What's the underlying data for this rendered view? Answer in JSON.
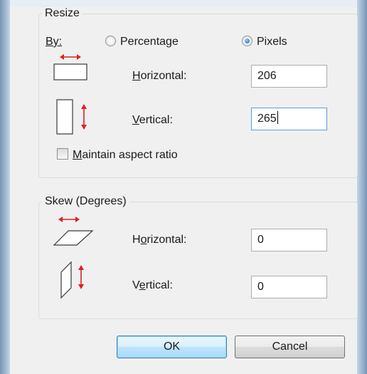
{
  "resize": {
    "legend": "Resize",
    "by_label": "By:",
    "percentage_label": "Percentage",
    "pixels_label": "Pixels",
    "selected": "Pixels",
    "horizontal_label": "Horizontal:",
    "horizontal_value": "206",
    "vertical_label": "Vertical:",
    "vertical_value": "265",
    "maintain_label": "Maintain aspect ratio",
    "maintain_checked": false
  },
  "skew": {
    "legend": "Skew (Degrees)",
    "horizontal_label": "Horizontal:",
    "horizontal_value": "0",
    "vertical_label": "Vertical:",
    "vertical_value": "0"
  },
  "buttons": {
    "ok": "OK",
    "cancel": "Cancel"
  },
  "colors": {
    "arrow": "#e02020",
    "focus_border": "#569de5"
  },
  "icons": [
    "resize-horizontal-icon",
    "resize-vertical-icon",
    "skew-horizontal-icon",
    "skew-vertical-icon"
  ]
}
